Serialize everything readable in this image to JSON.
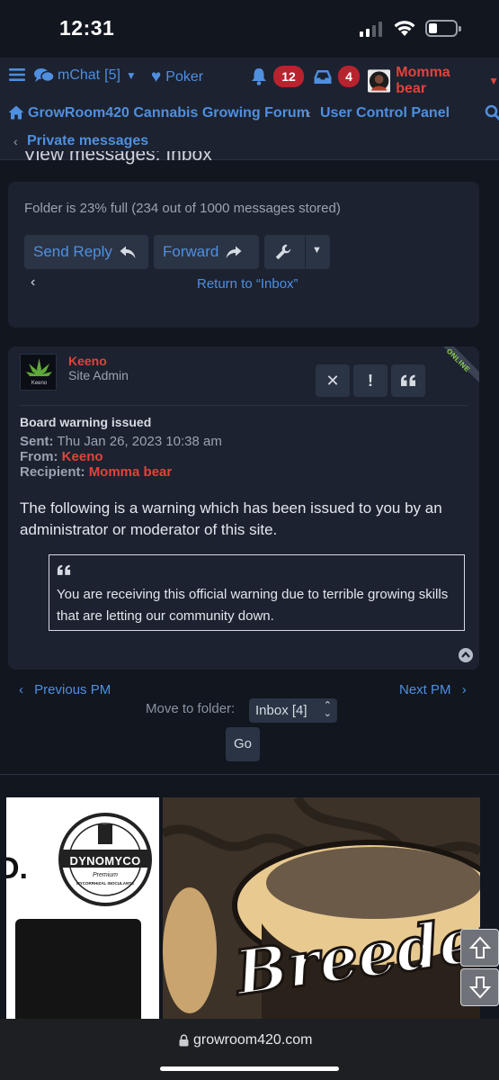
{
  "status": {
    "time": "12:31"
  },
  "nav": {
    "mchat_label": "mChat",
    "mchat_count": "[5]",
    "poker_label": "Poker",
    "notifications_count": "12",
    "messages_count": "4",
    "username": "Momma bear"
  },
  "breadcrumbs": {
    "forum": "GrowRoom420 Cannabis Growing Forum",
    "ucp": "User Control Panel",
    "pm": "Private messages"
  },
  "heading": "View messages: Inbox",
  "folder_panel": {
    "folder_status": "Folder is 23% full (234 out of 1000 messages stored)",
    "send_reply": "Send Reply",
    "forward": "Forward",
    "return_link": "Return to “Inbox”"
  },
  "message": {
    "author": "Keeno",
    "rank": "Site Admin",
    "online_label": "ONLINE",
    "avatar_text": "Keeno",
    "subject": "Board warning issued",
    "sent_label": "Sent:",
    "sent_value": "Thu Jan 26, 2023 10:38 am",
    "from_label": "From:",
    "from_value": "Keeno",
    "recipient_label": "Recipient:",
    "recipient_value": "Momma bear",
    "body": "The following is a warning which has been issued to you by an administrator or moderator of this site.",
    "quote": "You are receiving this official warning due to terrible growing skills that are letting our community down."
  },
  "pager": {
    "previous": "Previous PM",
    "next": "Next PM",
    "move_label": "Move to folder:",
    "folder_option": "Inbox [4]",
    "go": "Go"
  },
  "ads": {
    "left_brand": "DYNOMYCO",
    "left_sub": "MYCORRHIZAL INOCULANTS",
    "left_premium": "Premium",
    "right_text": "Breeder"
  },
  "browser": {
    "url": "growroom420.com"
  },
  "colors": {
    "accent": "#4f8fe0",
    "username_red": "#e0443a",
    "badge": "#b8232e",
    "panel": "#1c2230",
    "online": "#8bd04b"
  }
}
